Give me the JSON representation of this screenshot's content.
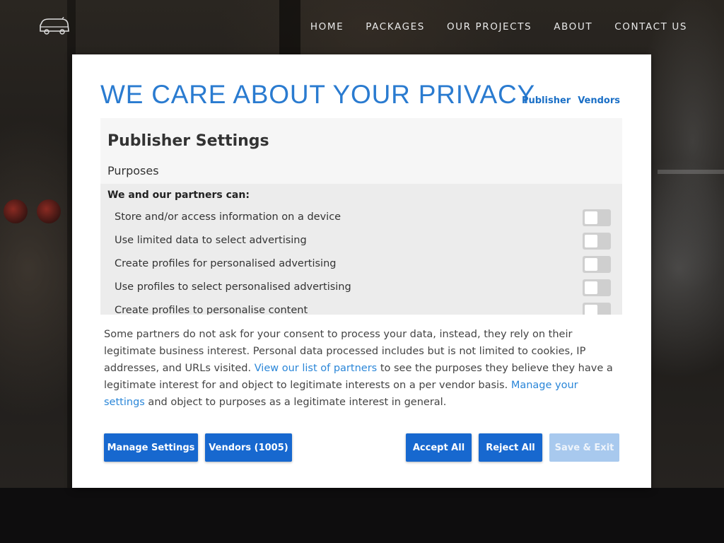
{
  "nav": {
    "items": [
      "HOME",
      "PACKAGES",
      "OUR PROJECTS",
      "ABOUT",
      "CONTACT US"
    ]
  },
  "modal": {
    "title": "WE CARE ABOUT YOUR PRIVACY",
    "top_links": [
      "Publisher",
      "Vendors"
    ],
    "settings_heading": "Publisher Settings",
    "purposes_heading": "Purposes",
    "partners_can": "We and our partners can:",
    "purposes": [
      {
        "label": "Store and/or access information on a device",
        "enabled": false
      },
      {
        "label": "Use limited data to select advertising",
        "enabled": false
      },
      {
        "label": "Create profiles for personalised advertising",
        "enabled": false
      },
      {
        "label": "Use profiles to select personalised advertising",
        "enabled": false
      },
      {
        "label": "Create profiles to personalise content",
        "enabled": false
      }
    ],
    "legit": {
      "part1": "Some partners do not ask for your consent to process your data, instead, they rely on their legitimate business interest. Personal data processed includes but is not limited to cookies, IP addresses, and URLs visited. ",
      "link1": "View our list of partners",
      "part2": " to see the purposes they believe they have a legitimate interest for and object to legitimate interests on a per vendor basis. ",
      "link2": "Manage your settings",
      "part3": " and object to purposes as a legitimate interest in general."
    },
    "buttons": {
      "manage": "Manage Settings",
      "vendors": "Vendors (1005)",
      "accept": "Accept All",
      "reject": "Reject All",
      "save": "Save & Exit"
    }
  },
  "colors": {
    "accent": "#1768cf",
    "title_blue": "#2a7bd0",
    "disabled_button": "#a8c9ee"
  }
}
